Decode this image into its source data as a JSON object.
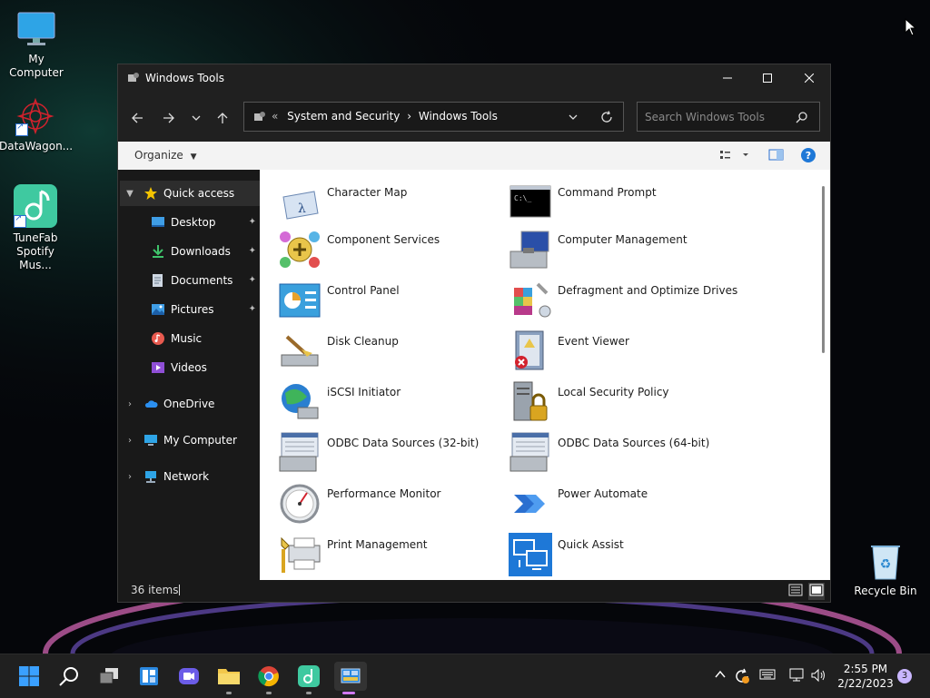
{
  "desktop": {
    "icons": [
      {
        "label": "My Computer"
      },
      {
        "label": "DataWagon..."
      },
      {
        "label": "TuneFab Spotify Mus..."
      }
    ],
    "recycle_bin": "Recycle Bin"
  },
  "window": {
    "title": "Windows Tools",
    "address": {
      "overflow": "«",
      "crumb1": "System and Security",
      "separator": "›",
      "crumb2": "Windows Tools"
    },
    "search_placeholder": "Search Windows Tools",
    "organize_label": "Organize",
    "nav": {
      "quick_access": "Quick access",
      "items": [
        {
          "label": "Desktop",
          "pinned": true
        },
        {
          "label": "Downloads",
          "pinned": true
        },
        {
          "label": "Documents",
          "pinned": true
        },
        {
          "label": "Pictures",
          "pinned": true
        },
        {
          "label": "Music",
          "pinned": false
        },
        {
          "label": "Videos",
          "pinned": false
        }
      ],
      "onedrive": "OneDrive",
      "my_computer": "My Computer",
      "network": "Network"
    },
    "tools": [
      {
        "label": "Character Map",
        "icon": "character-map-icon"
      },
      {
        "label": "Command Prompt",
        "icon": "command-prompt-icon"
      },
      {
        "label": "Component Services",
        "icon": "component-services-icon"
      },
      {
        "label": "Computer Management",
        "icon": "computer-management-icon"
      },
      {
        "label": "Control Panel",
        "icon": "control-panel-icon"
      },
      {
        "label": "Defragment and Optimize Drives",
        "icon": "defragment-icon"
      },
      {
        "label": "Disk Cleanup",
        "icon": "disk-cleanup-icon"
      },
      {
        "label": "Event Viewer",
        "icon": "event-viewer-icon"
      },
      {
        "label": "iSCSI Initiator",
        "icon": "iscsi-initiator-icon"
      },
      {
        "label": "Local Security Policy",
        "icon": "local-security-policy-icon"
      },
      {
        "label": "ODBC Data Sources (32-bit)",
        "icon": "odbc-32-icon"
      },
      {
        "label": "ODBC Data Sources (64-bit)",
        "icon": "odbc-64-icon"
      },
      {
        "label": "Performance Monitor",
        "icon": "performance-monitor-icon"
      },
      {
        "label": "Power Automate",
        "icon": "power-automate-icon"
      },
      {
        "label": "Print Management",
        "icon": "print-management-icon"
      },
      {
        "label": "Quick Assist",
        "icon": "quick-assist-icon"
      }
    ],
    "status": {
      "item_count": "36 items"
    }
  },
  "taskbar": {
    "clock_time": "2:55 PM",
    "clock_date": "2/22/2023",
    "notification_count": "3"
  },
  "colors": {
    "accent": "#0078d4",
    "window_dark": "#202020",
    "content_bg": "#ffffff"
  }
}
